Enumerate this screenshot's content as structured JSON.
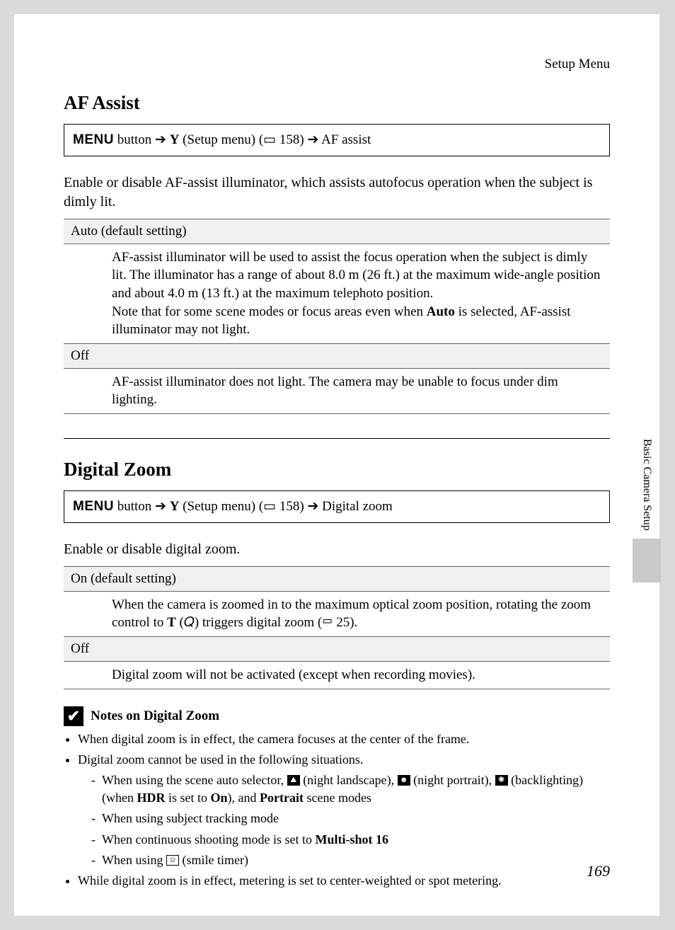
{
  "header": {
    "right": "Setup Menu"
  },
  "sidebar": {
    "label": "Basic Camera Setup"
  },
  "pageNumber": "169",
  "sec1": {
    "title": "AF Assist",
    "path": {
      "menuWord": "MENU",
      "afterMenu": " button ",
      "arrow": "➔",
      "wrench": "Y",
      "setupMenu": " (Setup menu) (",
      "book": "📖",
      "pageRef": " 158) ",
      "dest": " AF assist"
    },
    "desc": "Enable or disable AF-assist illuminator, which assists autofocus operation when the subject is dimly lit.",
    "opts": [
      {
        "name": "Auto (default setting)",
        "desc_pre": "AF-assist illuminator will be used to assist the focus operation when the subject is dimly lit. The illuminator has a range of about 8.0 m (26 ft.) at the maximum wide-angle position and about 4.0 m (13 ft.) at the maximum telephoto position.\nNote that for some scene modes or focus areas even when ",
        "bold1": "Auto",
        "desc_post": " is selected, AF-assist illuminator may not light."
      },
      {
        "name": "Off",
        "desc": "AF-assist illuminator does not light. The camera may be unable to focus under dim lighting."
      }
    ]
  },
  "sec2": {
    "title": "Digital Zoom",
    "path": {
      "menuWord": "MENU",
      "afterMenu": " button ",
      "arrow": "➔",
      "wrench": "Y",
      "setupMenu": " (Setup menu) (",
      "book": "📖",
      "pageRef": " 158) ",
      "dest": " Digital zoom"
    },
    "desc": "Enable or disable digital zoom.",
    "opts": [
      {
        "name": "On (default setting)",
        "desc_pre": "When the camera is zoomed in to the maximum optical zoom position, rotating the zoom control to ",
        "boldT": "T",
        "mag": "🔍",
        "desc_mid": " triggers digital zoom (",
        "book": "📖",
        "pageRef": " 25).",
        "desc_post": ""
      },
      {
        "name": "Off",
        "desc": "Digital zoom will not be activated (except when recording movies)."
      }
    ],
    "notes": {
      "title": "Notes on Digital Zoom",
      "b1": "When digital zoom is in effect, the camera focuses at the center of the frame.",
      "b2": "Digital zoom cannot be used in the following situations.",
      "s1_pre": "When using the scene auto selector, ",
      "s1_nl": " (night landscape), ",
      "s1_np": " (night portrait), ",
      "s1_bl": " (backlighting) (when ",
      "s1_hdr": "HDR",
      "s1_mid": " is set to ",
      "s1_on": "On",
      "s1_mid2": "), and ",
      "s1_por": "Portrait",
      "s1_end": " scene modes",
      "s2": "When using subject tracking mode",
      "s3_pre": "When continuous shooting mode is set to ",
      "s3_bold": "Multi-shot 16",
      "s4_pre": "When using ",
      "s4_post": " (smile timer)",
      "b3": "While digital zoom is in effect, metering is set to center-weighted or spot metering."
    }
  }
}
